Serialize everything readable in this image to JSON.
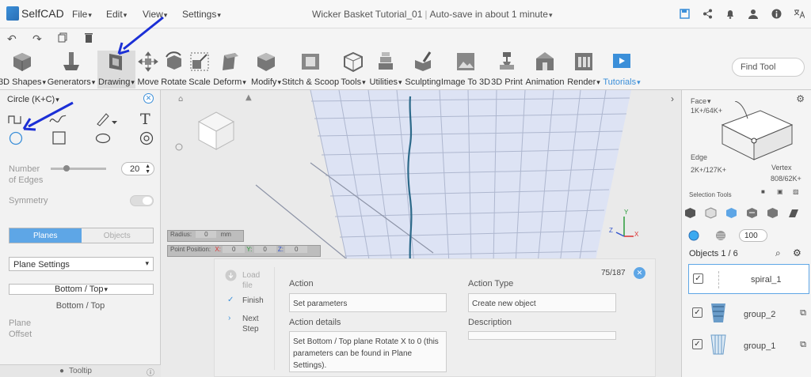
{
  "app": {
    "name": "SelfCAD"
  },
  "menu": [
    {
      "label": "File"
    },
    {
      "label": "Edit"
    },
    {
      "label": "View"
    },
    {
      "label": "Settings"
    }
  ],
  "document": {
    "title": "Wicker Basket Tutorial_01",
    "autosave": "Auto-save in about 1 minute"
  },
  "toolbar": [
    {
      "label": "3D Shapes",
      "icon": "cube-icon",
      "dropdown": true
    },
    {
      "label": "Generators",
      "icon": "generator-icon",
      "dropdown": true
    },
    {
      "label": "Drawing",
      "icon": "drawing-icon",
      "dropdown": true,
      "active": true
    },
    {
      "label": "Move",
      "icon": "move-icon"
    },
    {
      "label": "Rotate",
      "icon": "rotate-icon"
    },
    {
      "label": "Scale",
      "icon": "scale-icon"
    },
    {
      "label": "Deform",
      "icon": "deform-icon",
      "dropdown": true
    },
    {
      "label": "Modify",
      "icon": "modify-icon",
      "dropdown": true
    },
    {
      "label": "Stitch & Scoop",
      "icon": "stitch-icon"
    },
    {
      "label": "Tools",
      "icon": "tools-icon",
      "dropdown": true
    },
    {
      "label": "Utilities",
      "icon": "utilities-icon",
      "dropdown": true
    },
    {
      "label": "Sculpting",
      "icon": "sculpting-icon"
    },
    {
      "label": "Image To 3D",
      "icon": "image-icon"
    },
    {
      "label": "3D Print",
      "icon": "print-icon"
    },
    {
      "label": "Animation",
      "icon": "animation-icon"
    },
    {
      "label": "Render",
      "icon": "render-icon",
      "dropdown": true
    },
    {
      "label": "Tutorials",
      "icon": "tutorials-icon",
      "dropdown": true
    }
  ],
  "find_tool": "Find Tool",
  "left_panel": {
    "title": "Circle (K+C)",
    "edges_label": "Number of Edges",
    "edges_label_1": "Number",
    "edges_label_2": "of Edges",
    "edges_value": "20",
    "edges_slider": 0.25,
    "symmetry_label": "Symmetry",
    "tabs": [
      "Planes",
      "Objects"
    ],
    "plane_settings": "Plane Settings",
    "plane_select": "Bottom / Top",
    "plane_text": "Bottom / Top",
    "plane_offset_1": "Plane",
    "plane_offset_2": "Offset",
    "tooltip": "Tooltip"
  },
  "viewport": {
    "radius_label": "Radius:",
    "radius_value": "0",
    "radius_unit": "mm",
    "point_label": "Point Position:",
    "x": "X:",
    "x_val": "0",
    "y": "Y:",
    "y_val": "0",
    "z": "Z:",
    "z_val": "0",
    "axis_x": "X",
    "axis_y": "Y",
    "axis_z": "Z"
  },
  "tutorial": {
    "load_file_1": "Load",
    "load_file_2": "file",
    "finish": "Finish",
    "next_step_1": "Next",
    "next_step_2": "Step",
    "action_label": "Action",
    "action_value": "Set parameters",
    "details_label": "Action details",
    "details_value": "Set Bottom / Top plane Rotate X to 0 (this parameters can be found in Plane Settings).",
    "type_label": "Action Type",
    "type_value": "Create new object",
    "description_label": "Description",
    "counter": "75/187"
  },
  "right_panel": {
    "face": "Face",
    "face_count": "1K+/64K+",
    "edge": "Edge",
    "edge_count": "2K+/127K+",
    "vertex": "Vertex",
    "vertex_count": "808/62K+",
    "selection_tools": "Selection Tools",
    "brush_size": "100",
    "objects_header": "Objects 1 / 6",
    "objects": [
      {
        "name": "spiral_1",
        "selected": true
      },
      {
        "name": "group_2",
        "selected": false
      },
      {
        "name": "group_1",
        "selected": false
      }
    ]
  },
  "colors": {
    "accent": "#3b8fd9",
    "selected": "#5ea6e6",
    "annotation": "#1b2fd6"
  }
}
